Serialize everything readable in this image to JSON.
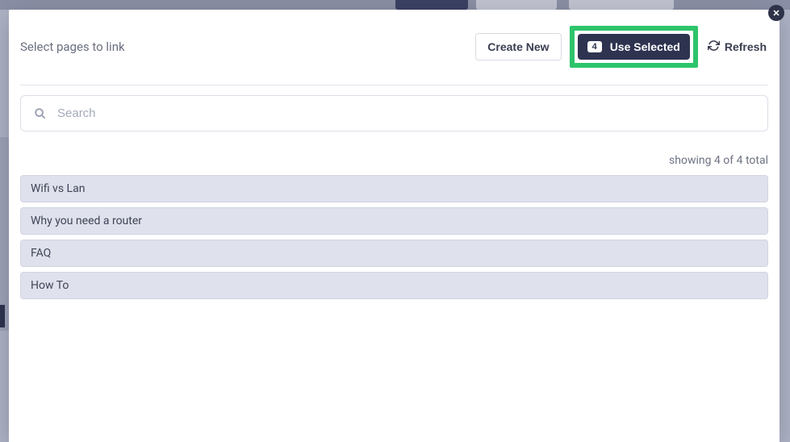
{
  "modal": {
    "title": "Select pages to link",
    "create_label": "Create New",
    "use_selected_count": "4",
    "use_selected_label": "Use Selected",
    "refresh_label": "Refresh"
  },
  "search": {
    "placeholder": "Search",
    "value": ""
  },
  "count_text": "showing 4 of 4 total",
  "items": [
    {
      "label": "Wifi vs Lan"
    },
    {
      "label": "Why you need a router"
    },
    {
      "label": "FAQ"
    },
    {
      "label": "How To"
    }
  ]
}
